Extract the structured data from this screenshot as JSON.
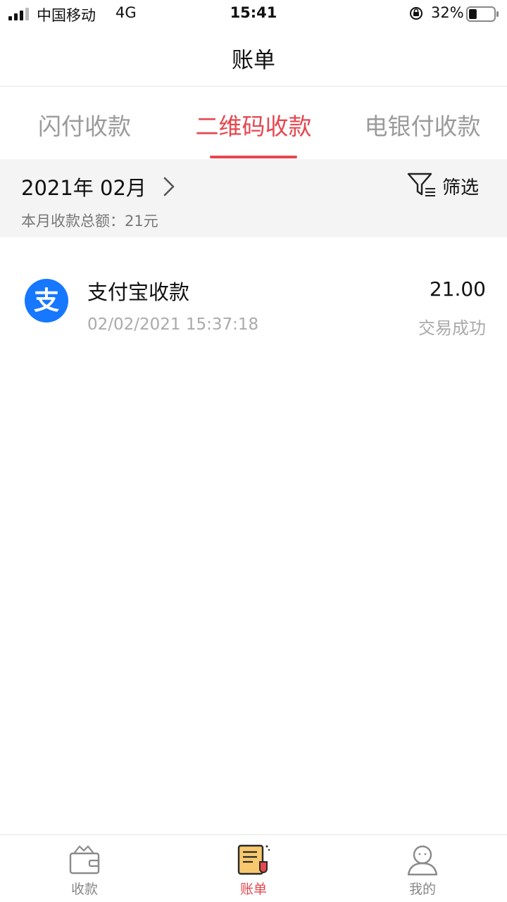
{
  "status_bar": {
    "carrier": "中国移动",
    "network": "4G",
    "time": "15:41",
    "battery": "32%",
    "battery_level": 0.32
  },
  "header": {
    "title": "账单"
  },
  "tabs": [
    {
      "label": "闪付收款",
      "active": false
    },
    {
      "label": "二维码收款",
      "active": true
    },
    {
      "label": "电银付收款",
      "active": false
    }
  ],
  "summary": {
    "month": "2021年 02月",
    "total": "本月收款总额：21元",
    "filter_label": "筛选"
  },
  "transactions": [
    {
      "name": "支付宝收款",
      "time": "02/02/2021 15:37:18",
      "amount": "21.00",
      "status": "交易成功",
      "icon": "alipay-icon"
    }
  ],
  "bottom_nav": [
    {
      "label": "收款",
      "icon": "wallet-icon",
      "active": false
    },
    {
      "label": "账单",
      "icon": "bill-icon",
      "active": true
    },
    {
      "label": "我的",
      "icon": "user-icon",
      "active": false
    }
  ],
  "colors": {
    "accent": "#e6474f",
    "alipay": "#1677ff",
    "muted": "#9b9b9b"
  }
}
